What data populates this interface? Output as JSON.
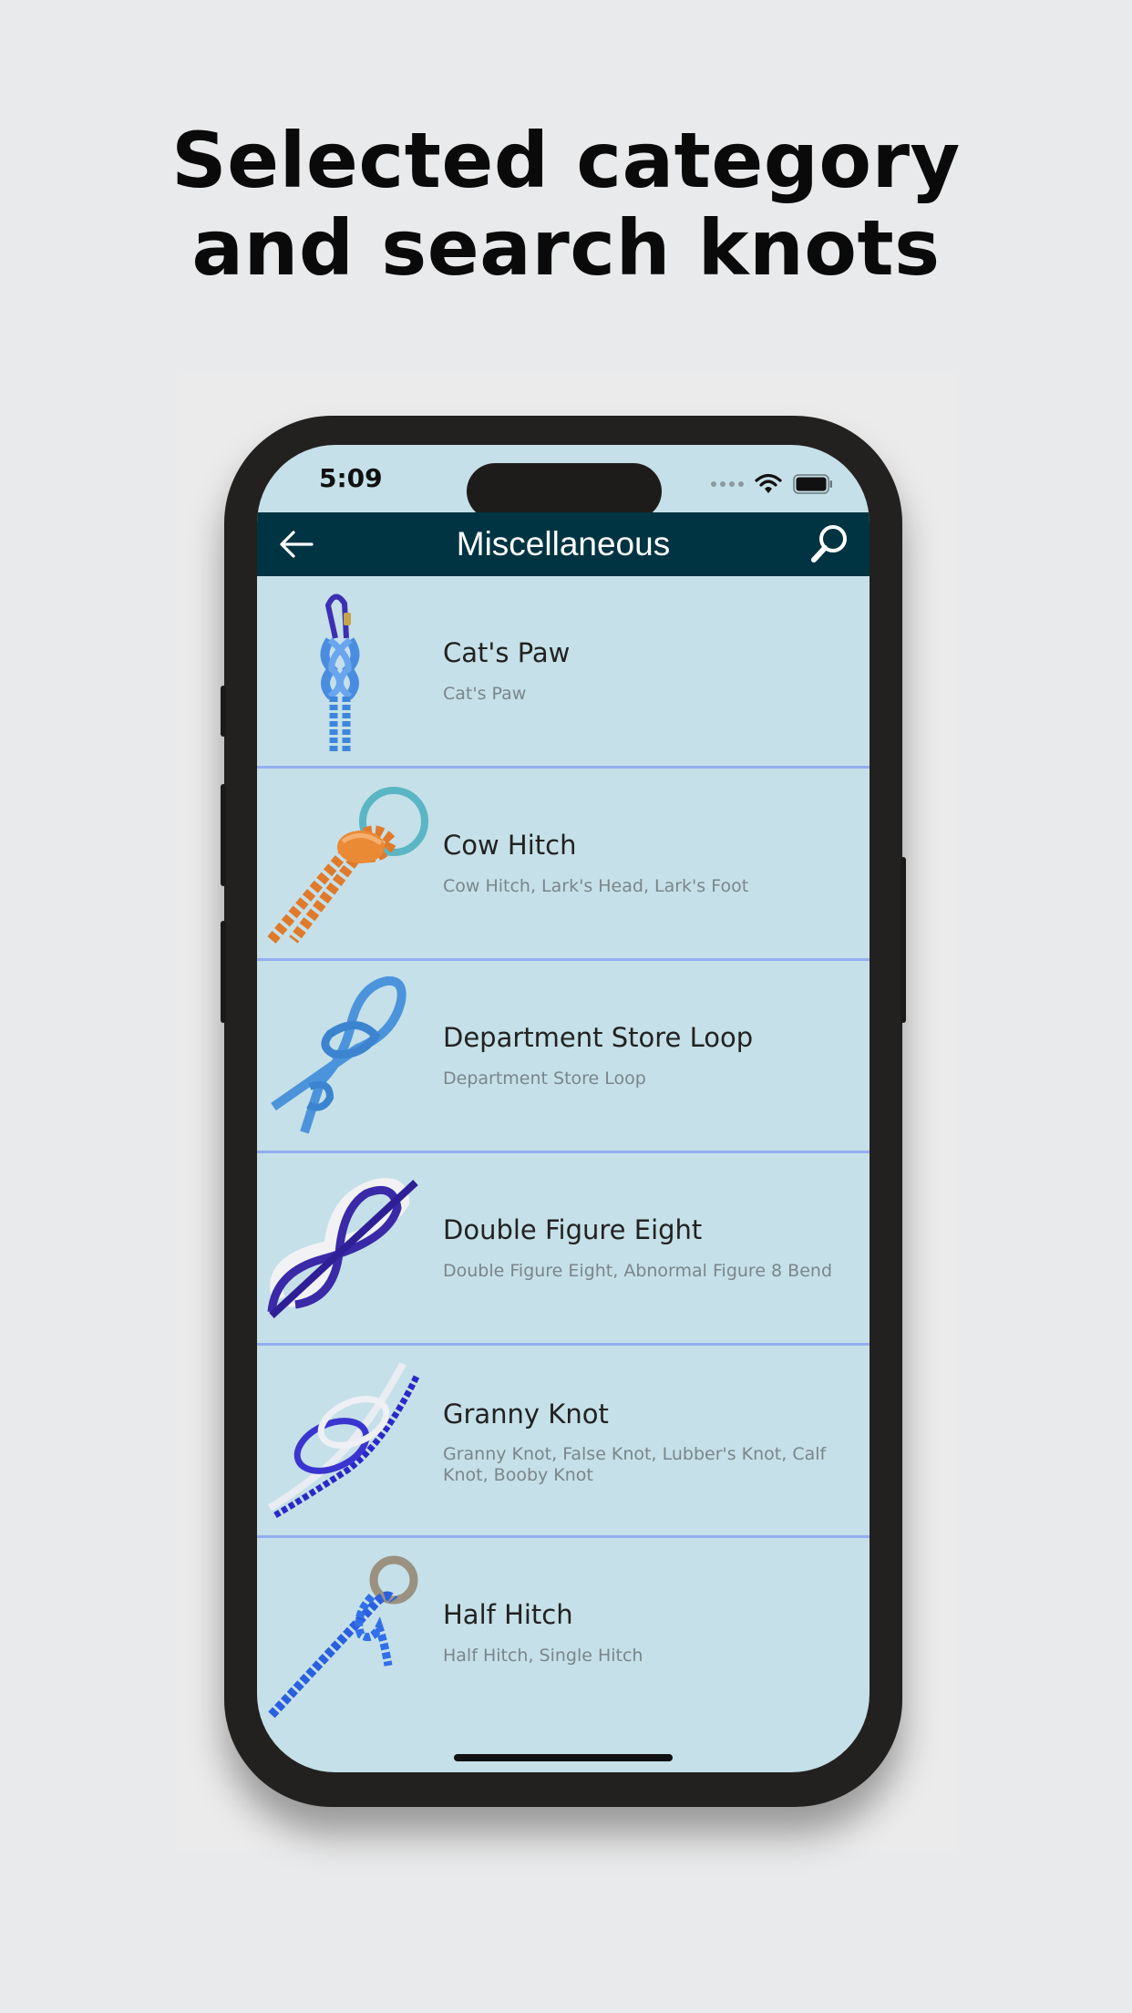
{
  "headline": {
    "line1": "Selected category",
    "line2": "and search knots"
  },
  "status_bar": {
    "time": "5:09"
  },
  "navbar": {
    "title": "Miscellaneous",
    "back_icon": "arrow-left-icon",
    "search_icon": "magnifier-icon"
  },
  "knots": [
    {
      "title": "Cat's Paw",
      "subtitle": "Cat's Paw",
      "icon": "cats-paw-knot-icon"
    },
    {
      "title": "Cow Hitch",
      "subtitle": "Cow Hitch, Lark's Head, Lark's Foot",
      "icon": "cow-hitch-knot-icon"
    },
    {
      "title": "Department Store Loop",
      "subtitle": "Department Store Loop",
      "icon": "department-store-loop-icon"
    },
    {
      "title": "Double Figure Eight",
      "subtitle": "Double Figure Eight, Abnormal Figure 8 Bend",
      "icon": "double-figure-eight-icon"
    },
    {
      "title": "Granny Knot",
      "subtitle": "Granny Knot, False Knot, Lubber's Knot, Calf Knot, Booby Knot",
      "icon": "granny-knot-icon"
    },
    {
      "title": "Half Hitch",
      "subtitle": "Half Hitch, Single Hitch",
      "icon": "half-hitch-icon"
    }
  ],
  "colors": {
    "navbar": "#013442",
    "list_bg": "#c5e0e8",
    "divider": "#94aef0"
  }
}
